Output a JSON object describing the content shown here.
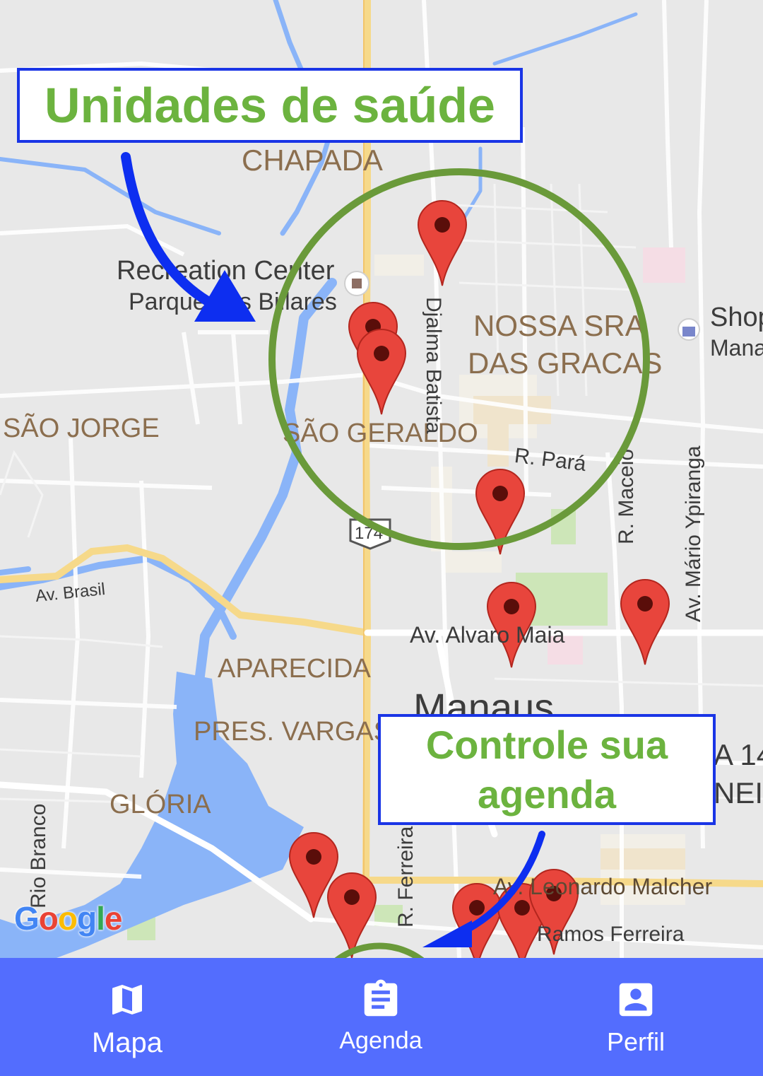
{
  "map": {
    "labels": {
      "chapada": "CHAPADA",
      "recreation_center": "Recreation Center",
      "parque_billares": "Parque dos Billares",
      "nossa_sra": "NOSSA SRA",
      "das_gracas": "DAS GRACAS",
      "sao_jorge": "SÃO JORGE",
      "sao_geraldo": "SÃO GERALDO",
      "r_para": "R. Pará",
      "djalma_batista": "Djalma Batista",
      "shop": "Shop",
      "mana": "Mana",
      "r_maceio": "R. Maceió",
      "av_mario_ypiranga": "Av. Mário Ypiranga",
      "av_brasil": "Av. Brasil",
      "route_174": "174",
      "av_alvaro_maia": "Av. Alvaro Maia",
      "aparecida": "APARECIDA",
      "manaus": "Manaus",
      "pres_vargas": "PRES. VARGAS",
      "gloria": "GLÓRIA",
      "rio_branco": "Rio Branco",
      "r_ferreira": "R. Ferreira",
      "av_leonardo_malcher": "Av. Leonardo Malcher",
      "ramos_ferreira": "Ramos Ferreira",
      "a14": "A 14",
      "neir": "NEIR"
    },
    "google_logo": "Google"
  },
  "callouts": {
    "health_units": "Unidades de saúde",
    "agenda_line1": "Controle sua",
    "agenda_line2": "agenda"
  },
  "nav": {
    "mapa": "Mapa",
    "agenda": "Agenda",
    "perfil": "Perfil"
  },
  "colors": {
    "nav_bg": "#536dfe",
    "callout_text": "#6cb33f",
    "callout_border": "#1a35e6",
    "circle": "#6a9a3a",
    "pin": "#e8453c",
    "water": "#8ab4f8",
    "road_major": "#f6d98a"
  },
  "icons": {
    "mapa": "map-icon",
    "agenda": "clipboard-icon",
    "perfil": "account-box-icon"
  }
}
